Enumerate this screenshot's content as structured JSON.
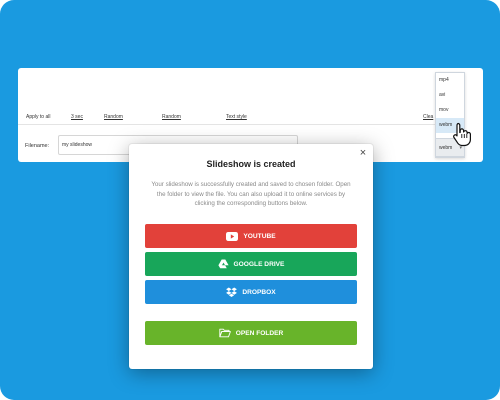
{
  "editor": {
    "apply_to_all_label": "Apply to all",
    "duration_value": "3 sec",
    "transition_1": "Random",
    "transition_2": "Random",
    "text_style_label": "Text style",
    "clear_label": "Clea",
    "filename_label": "Filename:",
    "filename_value": "my slideshow"
  },
  "format": {
    "options": [
      "mp4",
      "avi",
      "mov",
      "webm"
    ],
    "highlighted": "webm",
    "selected_value": "webm"
  },
  "modal": {
    "title": "Slideshow is created",
    "message": "Your slideshow is successfully created and saved to chosen folder. Open the folder to view the file. You can also upload it to online services by clicking the corresponding buttons below.",
    "buttons": {
      "youtube": "YOUTUBE",
      "google_drive": "GOOGLE DRIVE",
      "dropbox": "DROPBOX",
      "open_folder": "OPEN FOLDER"
    }
  },
  "colors": {
    "background": "#1a9ae0",
    "youtube": "#e2413a",
    "google_drive": "#18a65a",
    "dropbox": "#1f8fdc",
    "open_folder": "#68b42a"
  },
  "icons": {
    "close": "close-icon",
    "youtube": "youtube-icon",
    "drive": "google-drive-icon",
    "dropbox": "dropbox-icon",
    "folder": "folder-open-icon",
    "cursor": "hand-pointer-icon",
    "chevron": "chevron-down-icon"
  }
}
